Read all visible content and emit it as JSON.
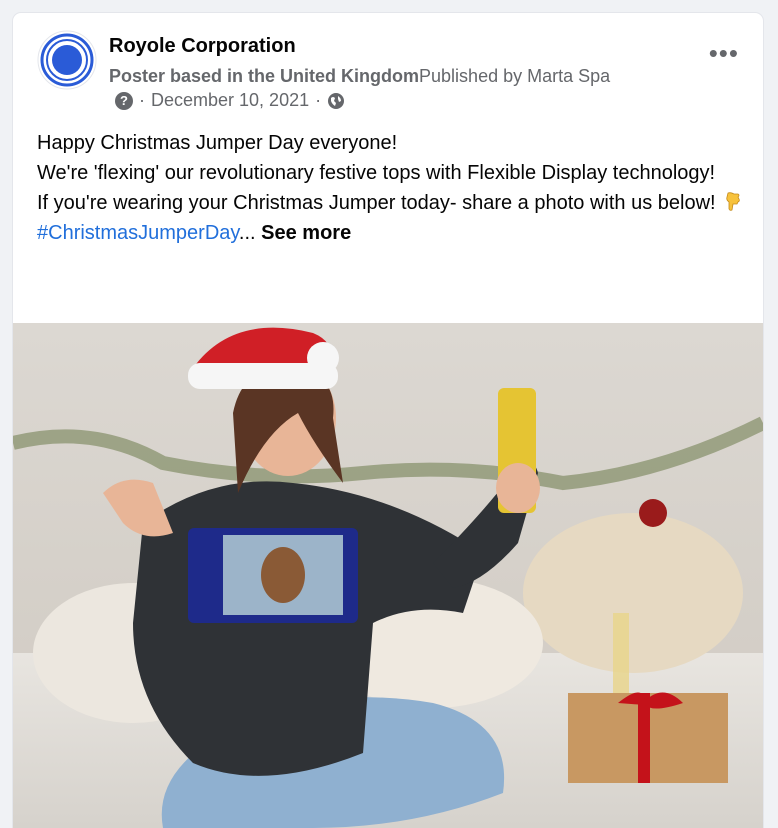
{
  "post": {
    "author": "Royole Corporation",
    "poster_label": "Poster based in the United Kingdom",
    "published_by": "Published by Marta Spa",
    "date": "December 10, 2021",
    "separator": "·",
    "more_label": "•••",
    "help_icon": "question-icon",
    "audience_icon": "globe-icon",
    "lines": [
      "Happy Christmas Jumper Day everyone!",
      "We're 'flexing' our revolutionary festive tops with Flexible Display technology!",
      "If you're wearing your Christmas Jumper today- share a photo with us below!"
    ],
    "emoji": "backhand-index-pointing-down",
    "hashtag": "#ChristmasJumperDay",
    "ellipsis": "...",
    "see_more": "See more"
  },
  "colors": {
    "brand_blue": "#2a5bd7",
    "link": "#216fdb",
    "secondary_text": "#65676b"
  }
}
